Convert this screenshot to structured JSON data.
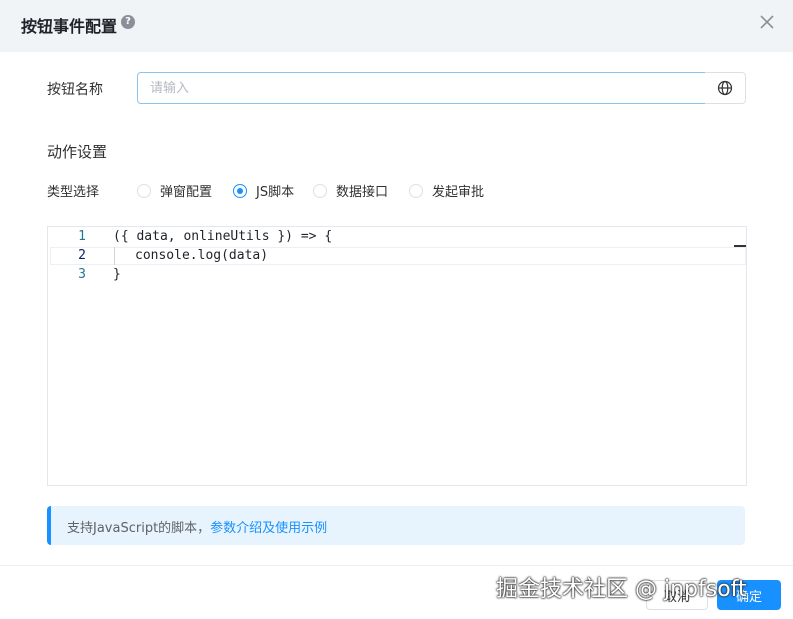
{
  "dialog": {
    "title": "按钮事件配置",
    "help_glyph": "?"
  },
  "form": {
    "name_label": "按钮名称",
    "name_placeholder": "请输入",
    "name_value": ""
  },
  "action": {
    "section_title": "动作设置",
    "type_label": "类型选择",
    "options": [
      {
        "label": "弹窗配置",
        "selected": false
      },
      {
        "label": "JS脚本",
        "selected": true
      },
      {
        "label": "数据接口",
        "selected": false
      },
      {
        "label": "发起审批",
        "selected": false
      }
    ]
  },
  "editor": {
    "lines": [
      {
        "no": "1",
        "code": "({ data, onlineUtils }) => {"
      },
      {
        "no": "2",
        "code": "console.log(data)"
      },
      {
        "no": "3",
        "code": "}"
      }
    ]
  },
  "tip": {
    "text": "支持JavaScript的脚本，",
    "link": "参数介绍及使用示例"
  },
  "footer": {
    "cancel_label": "取消",
    "ok_label": "确定"
  },
  "watermark": "掘金技术社区 @ jnpfsoft",
  "colors": {
    "primary": "#1890ff",
    "header_bg": "#f1f4f7",
    "tip_bg": "#e8f4fd"
  }
}
